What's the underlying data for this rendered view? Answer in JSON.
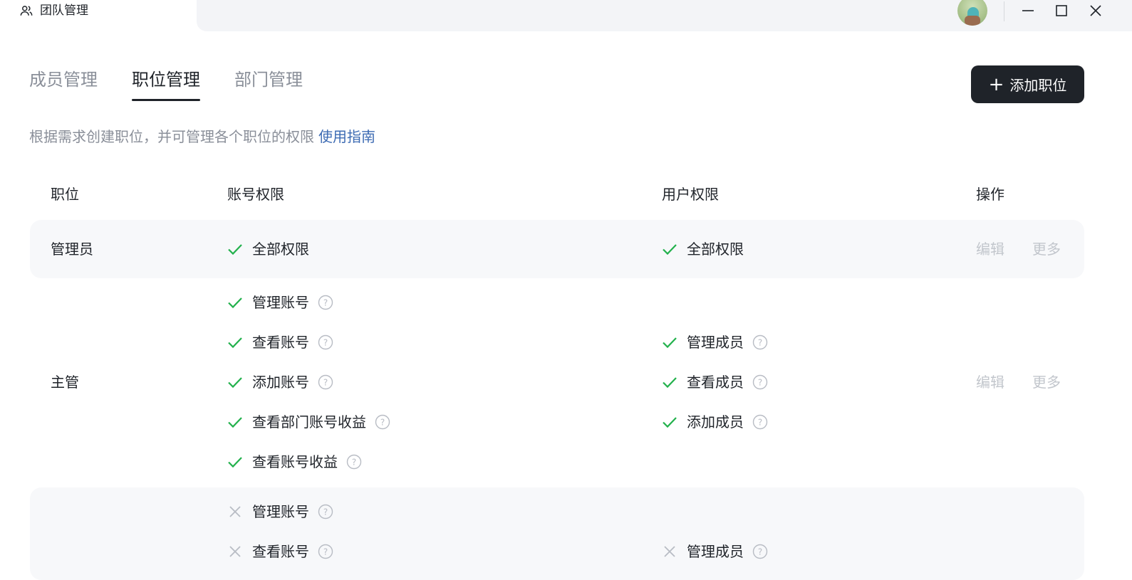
{
  "window": {
    "title": "团队管理",
    "icons": {
      "app": "team-icon",
      "minimize": "minimize-icon",
      "maximize": "maximize-icon",
      "close": "close-icon"
    }
  },
  "tabs": [
    {
      "label": "成员管理",
      "active": false
    },
    {
      "label": "职位管理",
      "active": true
    },
    {
      "label": "部门管理",
      "active": false
    }
  ],
  "add_button": {
    "label": "添加职位",
    "icon": "plus-icon"
  },
  "description": {
    "text": "根据需求创建职位，并可管理各个职位的权限",
    "link": "使用指南"
  },
  "table": {
    "headers": {
      "role": "职位",
      "account": "账号权限",
      "user": "用户权限",
      "ops": "操作"
    },
    "rows": [
      {
        "role": "管理员",
        "account": [
          {
            "label": "全部权限",
            "granted": true,
            "help": false
          }
        ],
        "user": [
          {
            "label": "全部权限",
            "granted": true,
            "help": false
          }
        ],
        "edit": "编辑",
        "more": "更多"
      },
      {
        "role": "主管",
        "account": [
          {
            "label": "管理账号",
            "granted": true,
            "help": true
          },
          {
            "label": "查看账号",
            "granted": true,
            "help": true
          },
          {
            "label": "添加账号",
            "granted": true,
            "help": true
          },
          {
            "label": "查看部门账号收益",
            "granted": true,
            "help": true
          },
          {
            "label": "查看账号收益",
            "granted": true,
            "help": true
          }
        ],
        "user": [
          {
            "label": "管理成员",
            "granted": true,
            "help": true
          },
          {
            "label": "查看成员",
            "granted": true,
            "help": true
          },
          {
            "label": "添加成员",
            "granted": true,
            "help": true
          }
        ],
        "edit": "编辑",
        "more": "更多"
      },
      {
        "account": [
          {
            "label": "管理账号",
            "granted": false,
            "help": true
          },
          {
            "label": "查看账号",
            "granted": false,
            "help": true
          }
        ],
        "user": [
          {
            "label": "管理成员",
            "granted": false,
            "help": true
          }
        ]
      }
    ]
  },
  "colors": {
    "granted": "#22b14c",
    "denied": "#b8bcc4",
    "primary_button": "#1f2329",
    "link": "#3d6bb3"
  }
}
